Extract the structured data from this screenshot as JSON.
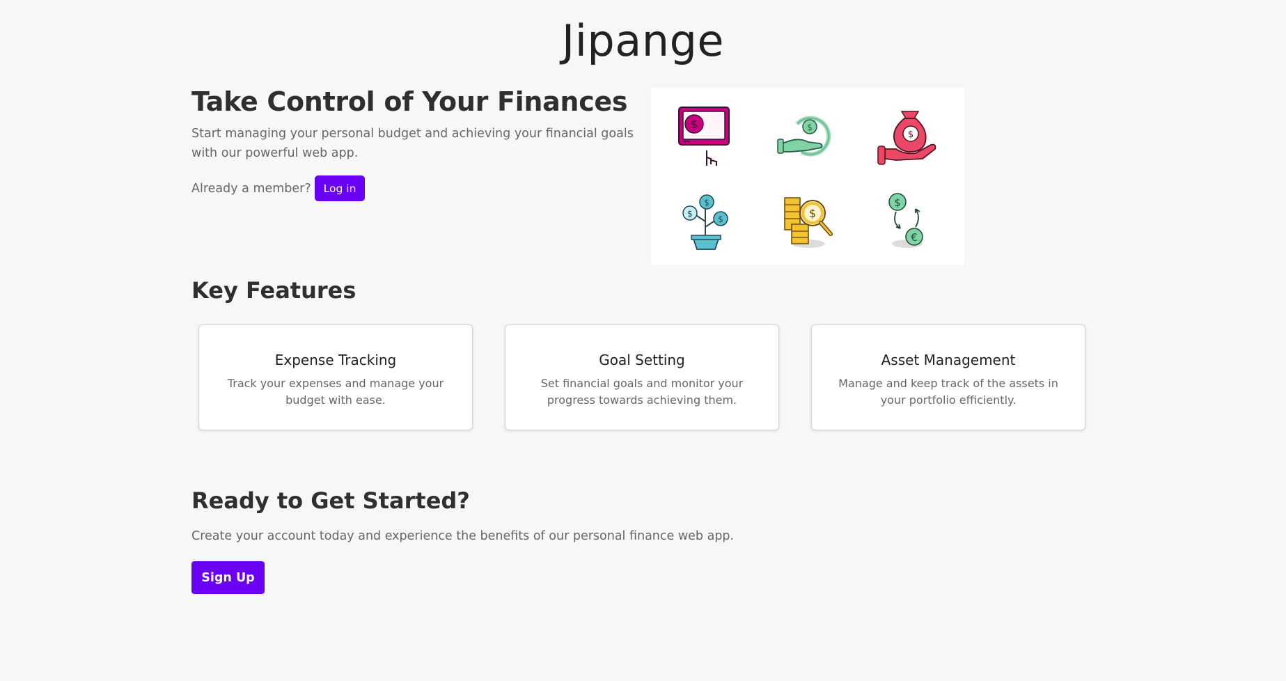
{
  "brand": {
    "title": "Jipange"
  },
  "hero": {
    "title": "Take Control of Your Finances",
    "text": "Start managing your personal budget and achieving your financial goals with our powerful web app.",
    "member_prompt": "Already a member?",
    "login_label": "Log in"
  },
  "illustration": {
    "icons": [
      "monitor-dollar-icon",
      "hand-recycle-coin-icon",
      "hand-money-bag-icon",
      "money-plant-icon",
      "coins-magnifier-icon",
      "dollar-euro-exchange-icon"
    ]
  },
  "features": {
    "title": "Key Features",
    "items": [
      {
        "title": "Expense Tracking",
        "text": "Track your expenses and manage your budget with ease."
      },
      {
        "title": "Goal Setting",
        "text": "Set financial goals and monitor your progress towards achieving them."
      },
      {
        "title": "Asset Management",
        "text": "Manage and keep track of the assets in your portfolio efficiently."
      }
    ]
  },
  "cta": {
    "title": "Ready to Get Started?",
    "text": "Create your account today and experience the benefits of our personal finance web app.",
    "signup_label": "Sign Up"
  },
  "colors": {
    "accent": "#6a00f4",
    "background": "#f7f7f7",
    "icon_magenta": "#c8007e",
    "icon_green": "#7fd3a5",
    "icon_pink": "#ea4867",
    "icon_teal": "#5bc0d0",
    "icon_gold": "#f2c230"
  }
}
